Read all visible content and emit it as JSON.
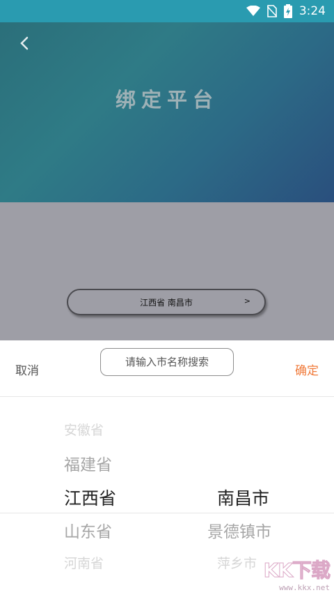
{
  "status": {
    "time": "3:24"
  },
  "header": {
    "title": "绑定平台"
  },
  "selector": {
    "value": "江西省 南昌市",
    "arrow": ">"
  },
  "picker": {
    "cancel_label": "取消",
    "confirm_label": "确定",
    "search_placeholder": "请输入市名称搜索",
    "provinces": [
      "安徽省",
      "福建省",
      "江西省",
      "山东省",
      "河南省"
    ],
    "cities": [
      "南昌市",
      "景德镇市",
      "萍乡市"
    ]
  },
  "watermark": {
    "logo": "KK下载",
    "url": "www.kkx.net"
  },
  "colors": {
    "accent": "#f07a3a",
    "header_start": "#2b6f7a",
    "header_end": "#2a4f7d"
  }
}
